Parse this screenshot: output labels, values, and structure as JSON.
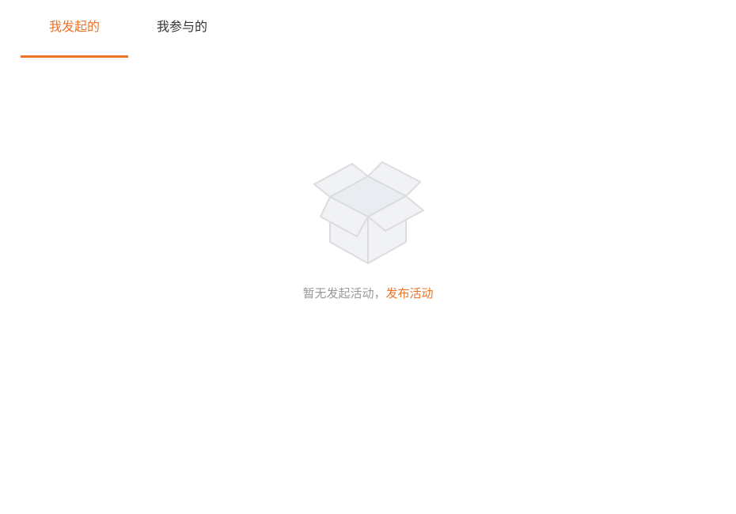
{
  "tabs": [
    {
      "label": "我发起的",
      "active": true
    },
    {
      "label": "我参与的",
      "active": false
    }
  ],
  "empty_state": {
    "icon": "open-box-icon",
    "message": "暂无发起活动，",
    "action_label": "发布活动"
  },
  "colors": {
    "accent": "#eb742a",
    "text": "#333333",
    "muted": "#999999",
    "icon_stroke": "#dcdcdc",
    "icon_fill": "#f0f2f5"
  }
}
